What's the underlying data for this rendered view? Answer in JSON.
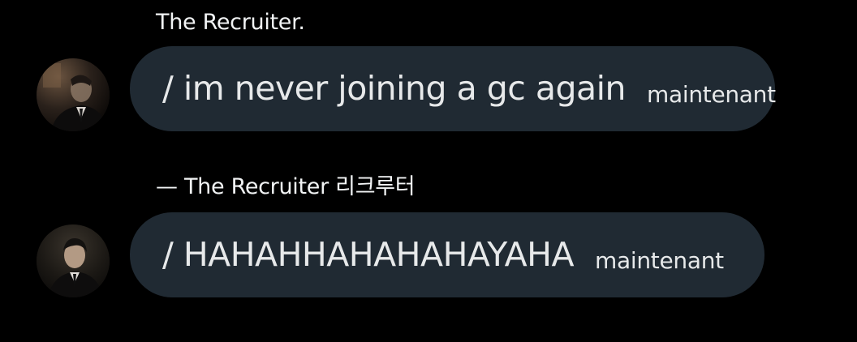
{
  "messages": [
    {
      "sender": "The Recruiter.",
      "text": "/ im never joining a gc again",
      "time": "maintenant",
      "avatar_icon": "profile-photo-man-in-suit-dim"
    },
    {
      "sender": "— The Recruiter 리크루터",
      "text": "/ HAHAHHAHAHAHAYAHA",
      "time": "maintenant",
      "avatar_icon": "profile-photo-man-in-suit"
    }
  ],
  "colors": {
    "background": "#000000",
    "bubble": "#202a33",
    "text": "#e7e9ea"
  }
}
